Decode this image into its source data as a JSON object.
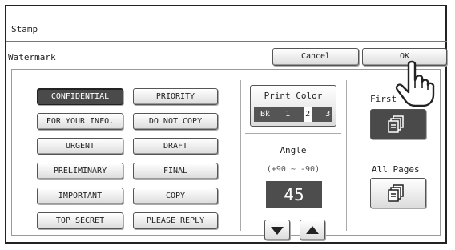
{
  "header": {
    "title": "Stamp"
  },
  "subheader": {
    "title": "Watermark",
    "cancel_label": "Cancel",
    "ok_label": "OK"
  },
  "stamps": [
    {
      "label": "CONFIDENTIAL",
      "selected": true
    },
    {
      "label": "PRIORITY",
      "selected": false
    },
    {
      "label": "FOR YOUR INFO.",
      "selected": false
    },
    {
      "label": "DO NOT COPY",
      "selected": false
    },
    {
      "label": "URGENT",
      "selected": false
    },
    {
      "label": "DRAFT",
      "selected": false
    },
    {
      "label": "PRELIMINARY",
      "selected": false
    },
    {
      "label": "FINAL",
      "selected": false
    },
    {
      "label": "IMPORTANT",
      "selected": false
    },
    {
      "label": "COPY",
      "selected": false
    },
    {
      "label": "TOP SECRET",
      "selected": false
    },
    {
      "label": "PLEASE REPLY",
      "selected": false
    }
  ],
  "print_color": {
    "label": "Print Color",
    "options": [
      "Bk",
      "1",
      "2",
      "3"
    ],
    "selected": "2"
  },
  "angle": {
    "label": "Angle",
    "range": "(+90 ~ -90)",
    "value": "45",
    "down_icon": "triangle-down-icon",
    "up_icon": "triangle-up-icon"
  },
  "pages": {
    "first_label": "First",
    "first_selected": true,
    "all_label": "All Pages",
    "all_selected": false,
    "icon": "stacked-pages-icon"
  },
  "cursor": {
    "icon": "pointing-hand-cursor-icon"
  }
}
